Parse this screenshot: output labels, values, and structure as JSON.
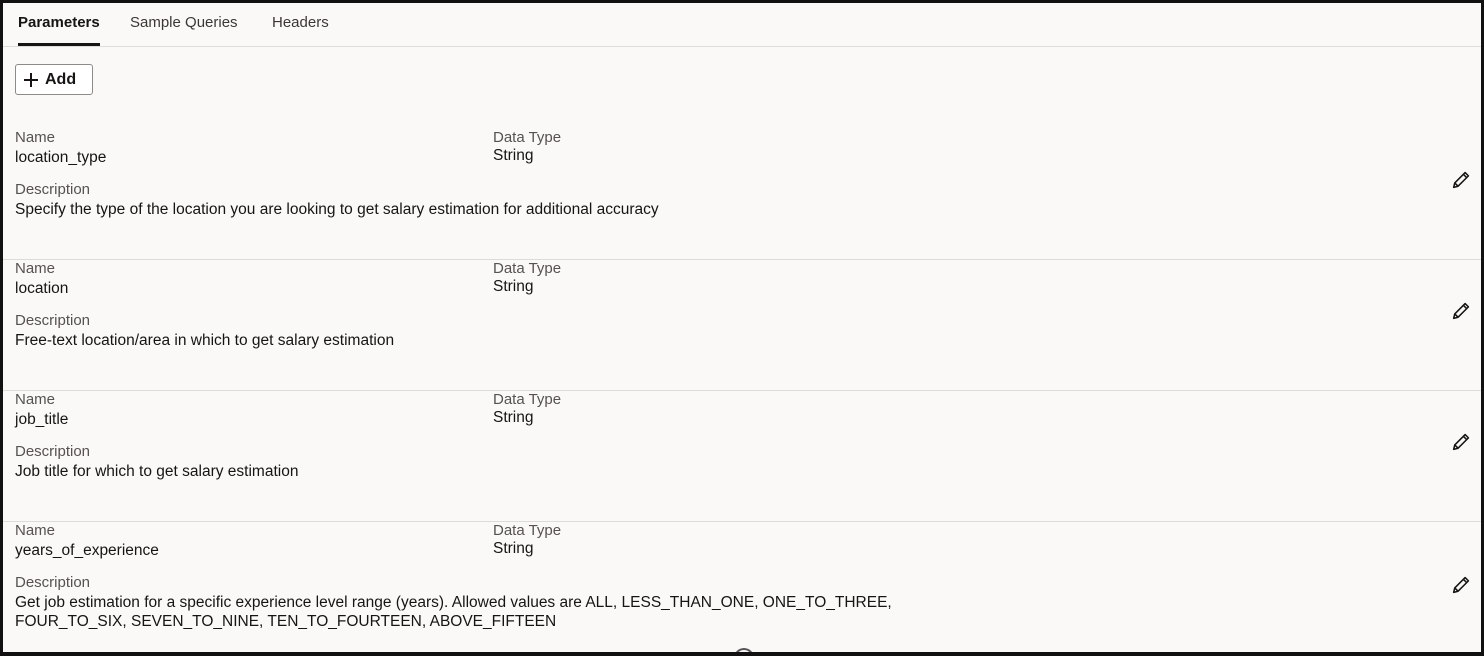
{
  "tabs": [
    {
      "label": "Parameters"
    },
    {
      "label": "Sample Queries"
    },
    {
      "label": "Headers"
    }
  ],
  "toolbar": {
    "add_label": "Add"
  },
  "params": {
    "name_label": "Name",
    "type_label": "Data Type",
    "desc_label": "Description",
    "items": [
      {
        "name": "location_type",
        "type": "String",
        "description": "Specify the type of the location you are looking to get salary estimation for additional accuracy"
      },
      {
        "name": "location",
        "type": "String",
        "description": "Free-text location/area in which to get salary estimation"
      },
      {
        "name": "job_title",
        "type": "String",
        "description": "Job title for which to get salary estimation"
      },
      {
        "name": "years_of_experience",
        "type": "String",
        "description": "Get job estimation for a specific experience level range (years). Allowed values are ALL, LESS_THAN_ONE, ONE_TO_THREE, FOUR_TO_SIX, SEVEN_TO_NINE, TEN_TO_FOURTEEN, ABOVE_FIFTEEN"
      }
    ]
  },
  "icons": {
    "add": "plus-icon",
    "edit": "pencil-icon"
  }
}
